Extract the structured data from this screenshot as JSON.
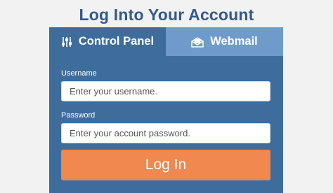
{
  "page": {
    "title": "Log Into Your Account"
  },
  "tabs": [
    {
      "label": "Control Panel",
      "icon": "sliders-icon",
      "active": true
    },
    {
      "label": "Webmail",
      "icon": "envelope-icon",
      "active": false
    }
  ],
  "form": {
    "username": {
      "label": "Username",
      "value": "",
      "placeholder": "Enter your username."
    },
    "password": {
      "label": "Password",
      "value": "",
      "placeholder": "Enter your account password."
    },
    "submit_label": "Log In"
  },
  "colors": {
    "title": "#33598a",
    "panel": "#3e6d9c",
    "inactive_tab": "#6f9bcb",
    "button": "#f0884f",
    "background": "#f2f2f2"
  }
}
